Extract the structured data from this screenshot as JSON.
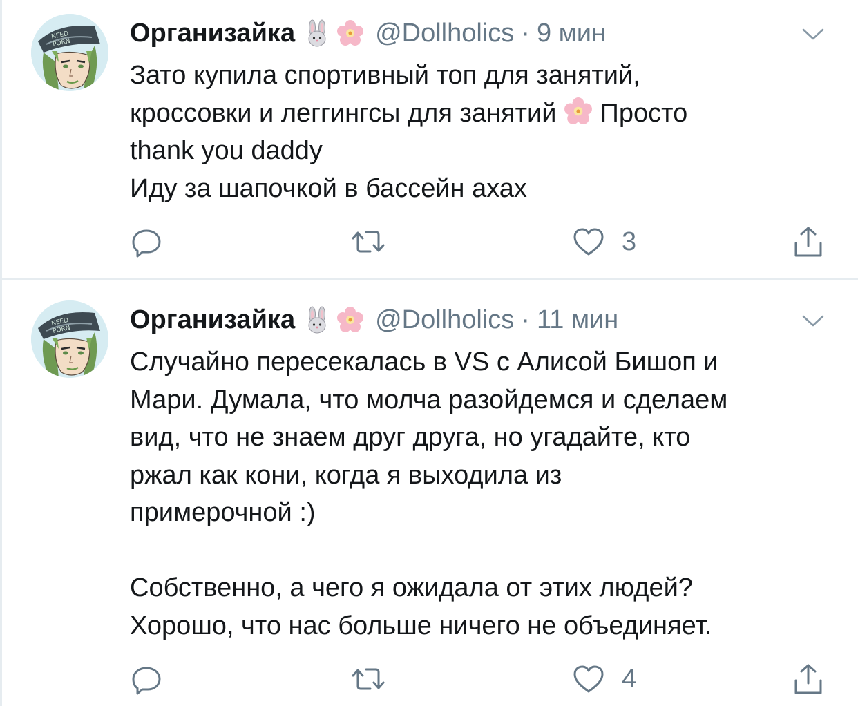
{
  "tweets": [
    {
      "author_name": "Организайка",
      "name_emojis": [
        "bunny-emoji",
        "cherry-blossom-emoji"
      ],
      "handle": "@Dollholics",
      "separator": "·",
      "time": "9 мин",
      "text_line1": "Зато купила спортивный топ для занятий,",
      "text_line2a": "кроссовки и леггингсы для занятий ",
      "text_line2_emoji": "cherry-blossom-emoji",
      "text_line2b": " Просто",
      "text_line3": "thank you daddy",
      "text_line4": "Иду за шапочкой в бассейн ахах",
      "reply_count": "",
      "retweet_count": "",
      "like_count": "3"
    },
    {
      "author_name": "Организайка",
      "name_emojis": [
        "bunny-emoji",
        "cherry-blossom-emoji"
      ],
      "handle": "@Dollholics",
      "separator": "·",
      "time": "11 мин",
      "text": "Случайно пересекалась в VS с Алисой Бишоп и\nМари. Думала, что молча разойдемся и сделаем\nвид, что не знаем друг друга, но угадайте, кто\nржал как кони, когда я выходила из\nпримерочной :)\n\nСобственно, а чего я ожидала от этих людей?\nХорошо, что нас больше ничего не объединяет.",
      "reply_count": "",
      "retweet_count": "",
      "like_count": "4"
    }
  ],
  "icons": {
    "reply": "reply-icon",
    "retweet": "retweet-icon",
    "like": "heart-icon",
    "share": "share-icon",
    "menu": "chevron-down-icon"
  },
  "colors": {
    "text": "#14171a",
    "secondary": "#657786",
    "divider": "#e6ecf0",
    "avatar_bg": "#d6ecf2"
  }
}
